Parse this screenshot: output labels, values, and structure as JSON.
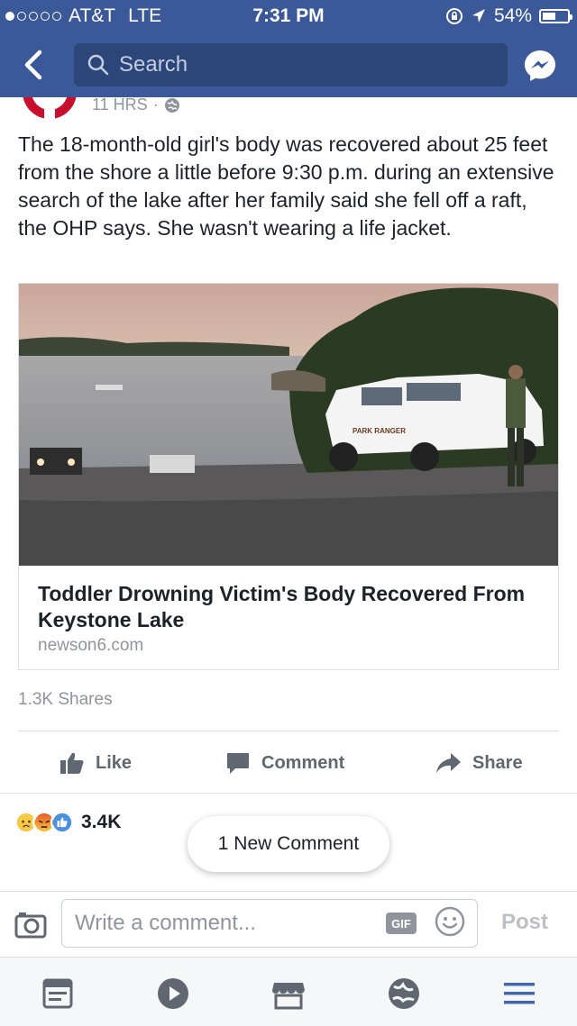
{
  "status_bar": {
    "carrier": "AT&T",
    "network": "LTE",
    "time": "7:31 PM",
    "battery": "54%",
    "battery_level": 0.54
  },
  "nav": {
    "search_placeholder": "Search"
  },
  "post": {
    "meta_time": "11 HRS",
    "meta_separator": "·",
    "text": "The 18-month-old girl's body was recovered about 25 feet from the shore a little before 9:30 p.m. during an extensive search of the lake after her family said she fell off a raft, the OHP says. She wasn't wearing a life jacket.",
    "link_card": {
      "headline": "Toddler Drowning Victim's Body Recovered From Keystone Lake",
      "domain": "newson6.com",
      "photo_vehicle_text": "PARK RANGER"
    },
    "shares": "1.3K Shares",
    "actions": {
      "like": "Like",
      "comment": "Comment",
      "share": "Share"
    },
    "reaction_count": "3.4K",
    "new_comment_pill": "1 New Comment"
  },
  "composer": {
    "placeholder": "Write a comment...",
    "gif_label": "GIF",
    "post_label": "Post"
  },
  "colors": {
    "brand": "#3b5998",
    "search_bg": "#2d4679",
    "muted_text": "#90949c",
    "action_text": "#606770"
  },
  "tabs": [
    "news-feed-icon",
    "video-icon",
    "marketplace-icon",
    "notifications-globe-icon",
    "menu-icon"
  ]
}
